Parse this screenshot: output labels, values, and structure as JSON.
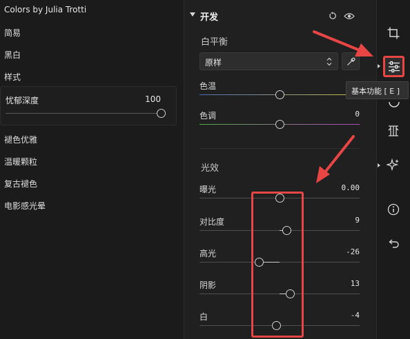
{
  "presets": {
    "title": "Colors by Julia Trotti",
    "items": [
      {
        "label": "简易"
      },
      {
        "label": "黑白"
      },
      {
        "label": "样式"
      }
    ],
    "amount": {
      "label": "忧郁深度",
      "value": "100",
      "fraction": 1.0
    },
    "items_below": [
      {
        "label": "褪色优雅"
      },
      {
        "label": "温暖颗粒"
      },
      {
        "label": "复古褪色"
      },
      {
        "label": "电影感光晕"
      }
    ]
  },
  "edit_panel": {
    "section_title": "开发",
    "white_balance": {
      "title": "白平衡",
      "select_value": "原样",
      "temp": {
        "label": "色温",
        "value": "",
        "position": 0.5
      },
      "tint": {
        "label": "色调",
        "value": "0",
        "position": 0.5
      }
    },
    "light": {
      "title": "光效",
      "sliders": [
        {
          "label": "曝光",
          "value": "0.00",
          "position": 0.5
        },
        {
          "label": "对比度",
          "value": "9",
          "position": 0.545
        },
        {
          "label": "高光",
          "value": "-26",
          "position": 0.37
        },
        {
          "label": "阴影",
          "value": "13",
          "position": 0.565
        },
        {
          "label": "白",
          "value": "-4",
          "position": 0.48
        }
      ]
    }
  },
  "toolbar": {
    "tools": [
      {
        "icon": "crop-icon"
      },
      {
        "icon": "sliders-icon",
        "active": true
      },
      {
        "icon": "color-wheel-icon"
      },
      {
        "icon": "grid-detail-icon"
      },
      {
        "icon": "sparkle-icon"
      },
      {
        "icon": "info-icon"
      },
      {
        "icon": "undo-icon"
      }
    ],
    "tooltip": "基本功能 [ E ]"
  },
  "colors": {
    "annotation": "#e84545",
    "temp_gradient": [
      "#4f6fb8",
      "#c8c04a"
    ],
    "tint_gradient": [
      "#55a84a",
      "#b04ab8"
    ]
  }
}
